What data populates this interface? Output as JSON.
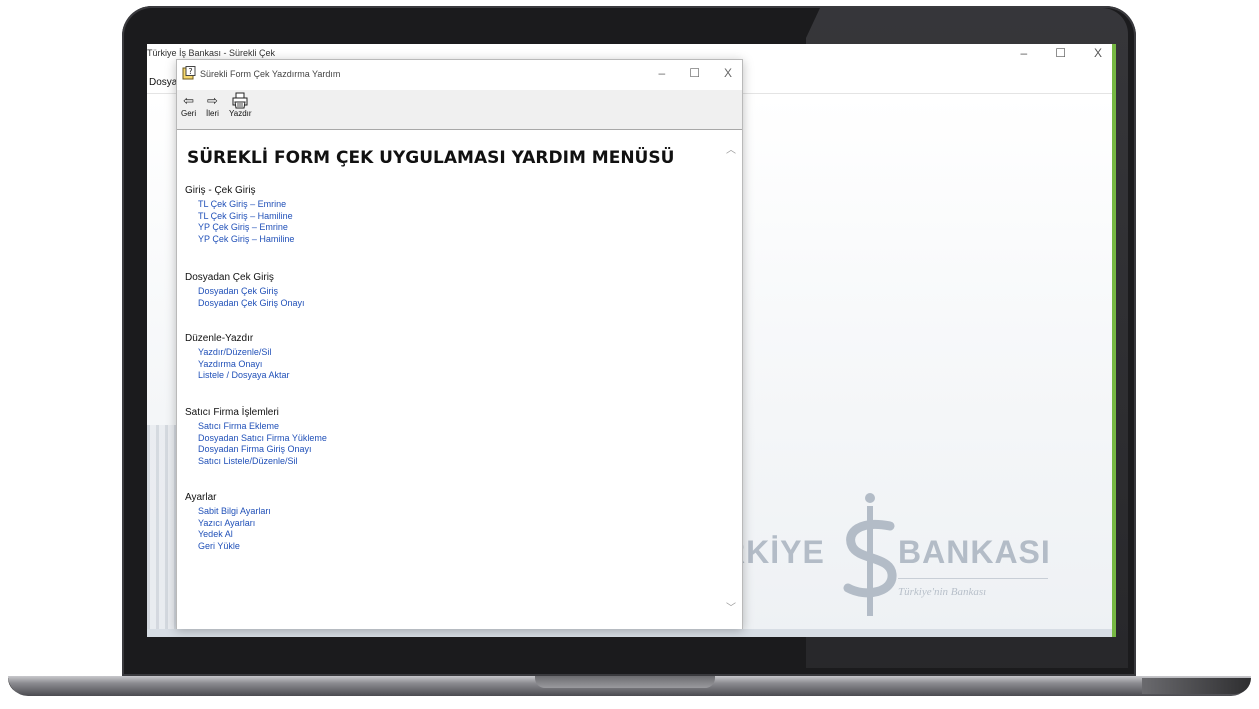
{
  "main_window": {
    "title": "Türkiye İş Bankası - Sürekli Çek",
    "menu": {
      "dosya": "Dosya"
    },
    "controls": {
      "minimize": "–",
      "maximize": "☐",
      "close": "X"
    }
  },
  "logo": {
    "left_text": "RKİYE",
    "right_text": "BANKASI",
    "tagline": "Türkiye'nin Bankası"
  },
  "help_window": {
    "title": "Sürekli Form Çek Yazdırma Yardım",
    "controls": {
      "minimize": "–",
      "maximize": "☐",
      "close": "X"
    },
    "toolbar": {
      "back": {
        "icon": "back-arrow-icon",
        "label": "Geri"
      },
      "forward": {
        "icon": "forward-arrow-icon",
        "label": "İleri"
      },
      "print": {
        "icon": "printer-icon",
        "label": "Yazdır"
      }
    },
    "heading": "SÜREKLİ FORM ÇEK UYGULAMASI YARDIM MENÜSÜ",
    "sections": [
      {
        "title": "Giriş - Çek Giriş",
        "links": [
          "TL Çek Giriş – Emrine",
          "TL Çek Giriş – Hamiline",
          "YP Çek Giriş – Emrine",
          "YP Çek Giriş – Hamiline"
        ]
      },
      {
        "title": "Dosyadan Çek Giriş",
        "links": [
          "Dosyadan Çek Giriş",
          "Dosyadan Çek Giriş Onayı"
        ]
      },
      {
        "title": "Düzenle-Yazdır",
        "links": [
          "Yazdır/Düzenle/Sil",
          "Yazdırma Onayı",
          "Listele / Dosyaya Aktar"
        ]
      },
      {
        "title": "Satıcı Firma İşlemleri",
        "links": [
          "Satıcı Firma Ekleme",
          "Dosyadan Satıcı Firma Yükleme",
          "Dosyadan Firma Giriş Onayı",
          "Satıcı Listele/Düzenle/Sil"
        ]
      },
      {
        "title": "Ayarlar",
        "links": [
          "Sabit Bilgi Ayarları",
          "Yazıcı Ayarları",
          "Yedek Al",
          "Geri Yükle"
        ]
      }
    ]
  }
}
